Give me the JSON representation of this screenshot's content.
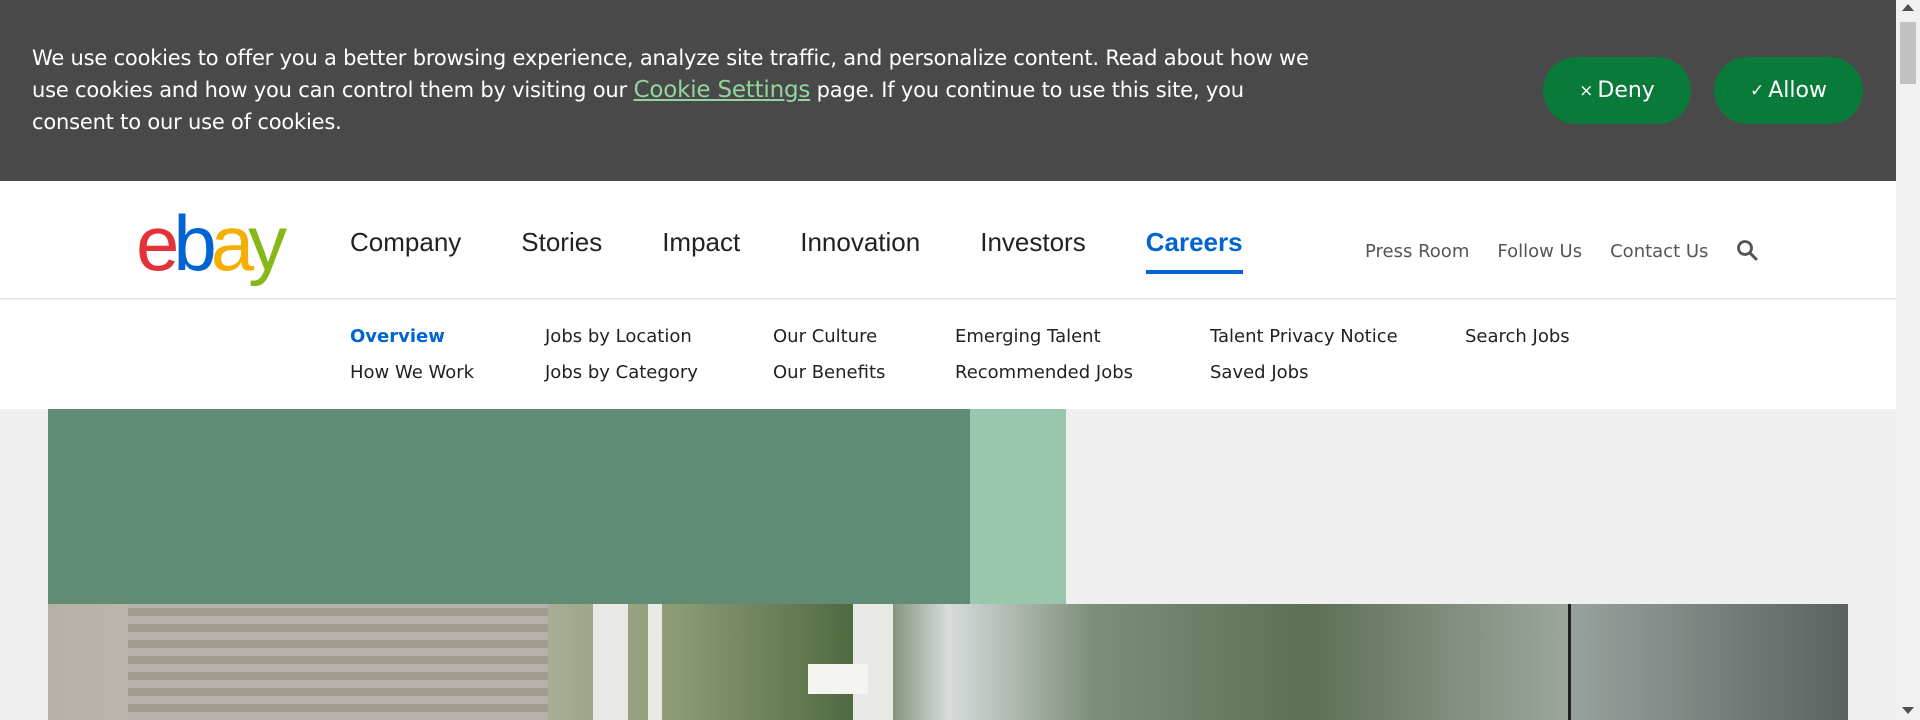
{
  "cookie_banner": {
    "text_before": "We use cookies to offer you a better browsing experience, analyze site traffic, and personalize content. Read about how we use cookies and how you can control them by visiting our ",
    "link": "Cookie Settings",
    "text_after": " page. If you continue to use this site, you consent to our use of cookies.",
    "deny_label": "Deny",
    "allow_label": "Allow",
    "deny_icon": "×",
    "allow_icon": "✓"
  },
  "logo": {
    "e": "e",
    "b": "b",
    "a": "a",
    "y": "y"
  },
  "main_nav": [
    "Company",
    "Stories",
    "Impact",
    "Innovation",
    "Investors",
    "Careers"
  ],
  "active_main_nav": "Careers",
  "util_nav": [
    "Press Room",
    "Follow Us",
    "Contact Us"
  ],
  "sub_nav": {
    "overview": "Overview",
    "how_we_work": "How We Work",
    "jobs_by_location": "Jobs by Location",
    "jobs_by_category": "Jobs by Category",
    "our_culture": "Our Culture",
    "our_benefits": "Our Benefits",
    "emerging_talent": "Emerging Talent",
    "recommended_jobs": "Recommended Jobs",
    "talent_privacy_notice": "Talent Privacy Notice",
    "saved_jobs": "Saved Jobs",
    "search_jobs": "Search Jobs"
  },
  "colors": {
    "banner_bg": "#494949",
    "button_green": "#0a7a3a",
    "link_green": "#93d59f",
    "accent_blue": "#0064d2",
    "hero_dark": "#608c76",
    "hero_light": "#99c7ae"
  }
}
